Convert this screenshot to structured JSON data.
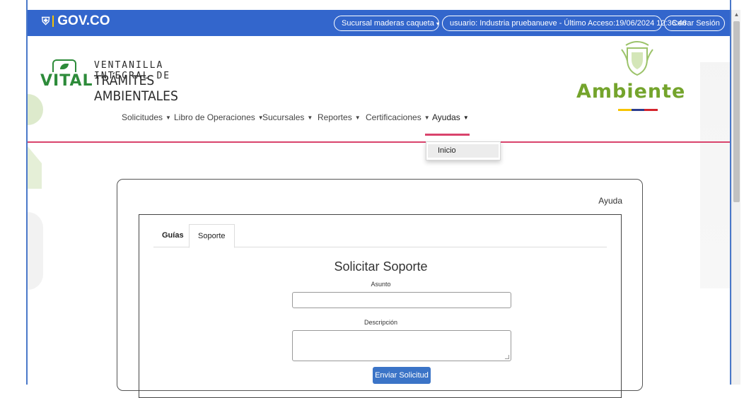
{
  "gov_bar": {
    "logo_text": "GOV.CO",
    "sucursal": "Sucursal maderas caqueta",
    "usuario": "usuario: Industria pruebanueve - Último Acceso:19/06/2024 12:36:46",
    "cerrar": "Cerrar Sesión",
    "color": "#3366cc"
  },
  "brand": {
    "vital": "VITAL",
    "line1": "VENTANILLA INTEGRAL DE",
    "line2": "TRÁMITES AMBIENTALES",
    "ambiente": "Ambiente",
    "green": "#2d8b3a",
    "ambiente_green": "#74a42c"
  },
  "nav": {
    "items": [
      {
        "label": "Solicitudes"
      },
      {
        "label": "Libro de Operaciones"
      },
      {
        "label": "Sucursales"
      },
      {
        "label": "Reportes"
      },
      {
        "label": "Certificaciones"
      },
      {
        "label": "Ayudas"
      }
    ],
    "active": "Ayudas",
    "accent": "#d9436c",
    "dropdown": [
      "Inicio"
    ]
  },
  "content": {
    "help_link": "Ayuda",
    "tabs": [
      "Guías",
      "Soporte"
    ],
    "active_tab": "Soporte",
    "form_title": "Solicitar Soporte",
    "asunto_label": "Asunto",
    "asunto_value": "",
    "desc_label": "Descripción",
    "desc_value": "",
    "submit": "Enviar Solicitud"
  }
}
